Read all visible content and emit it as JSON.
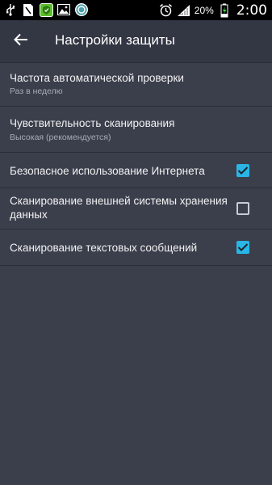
{
  "status_bar": {
    "left_icons": [
      "usb-icon",
      "sim-icon",
      "shield-app-icon",
      "image-icon",
      "sync-app-icon"
    ],
    "right_icons": [
      "alarm-icon",
      "signal-icon",
      "charging-icon"
    ],
    "battery_percent": "20%",
    "time": "2:00"
  },
  "app_bar": {
    "back_icon": "arrow-back-icon",
    "title": "Настройки защиты"
  },
  "settings": [
    {
      "title": "Частота автоматической проверки",
      "subtitle": "Раз в неделю"
    },
    {
      "title": "Чувствительность сканирования",
      "subtitle": "Высокая (рекомендуется)"
    },
    {
      "title": "Безопасное использование Интернета",
      "checked": true
    },
    {
      "title_line1": "Сканирование внешней системы хранения",
      "title_line2": "данных",
      "checked": false
    },
    {
      "title": "Сканирование текстовых сообщений",
      "checked": true
    }
  ],
  "colors": {
    "background": "#3b3f4c",
    "app_bar": "#333743",
    "accent": "#29b6e6"
  }
}
